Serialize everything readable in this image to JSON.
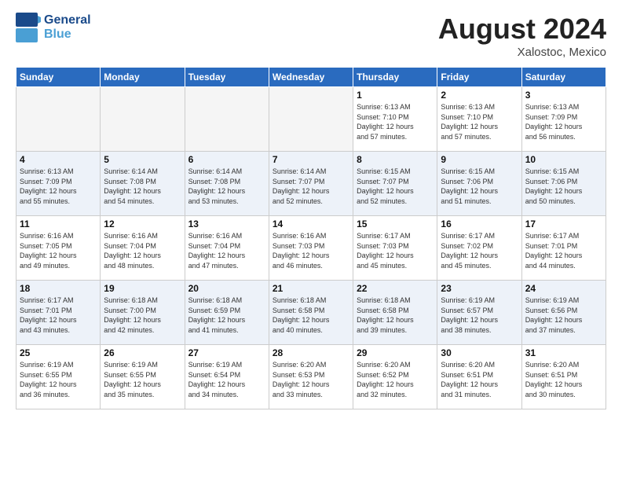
{
  "header": {
    "logo_line1": "General",
    "logo_line2": "Blue",
    "month_year": "August 2024",
    "location": "Xalostoc, Mexico"
  },
  "weekdays": [
    "Sunday",
    "Monday",
    "Tuesday",
    "Wednesday",
    "Thursday",
    "Friday",
    "Saturday"
  ],
  "weeks": [
    [
      {
        "day": "",
        "info": ""
      },
      {
        "day": "",
        "info": ""
      },
      {
        "day": "",
        "info": ""
      },
      {
        "day": "",
        "info": ""
      },
      {
        "day": "1",
        "info": "Sunrise: 6:13 AM\nSunset: 7:10 PM\nDaylight: 12 hours\nand 57 minutes."
      },
      {
        "day": "2",
        "info": "Sunrise: 6:13 AM\nSunset: 7:10 PM\nDaylight: 12 hours\nand 57 minutes."
      },
      {
        "day": "3",
        "info": "Sunrise: 6:13 AM\nSunset: 7:09 PM\nDaylight: 12 hours\nand 56 minutes."
      }
    ],
    [
      {
        "day": "4",
        "info": "Sunrise: 6:13 AM\nSunset: 7:09 PM\nDaylight: 12 hours\nand 55 minutes."
      },
      {
        "day": "5",
        "info": "Sunrise: 6:14 AM\nSunset: 7:08 PM\nDaylight: 12 hours\nand 54 minutes."
      },
      {
        "day": "6",
        "info": "Sunrise: 6:14 AM\nSunset: 7:08 PM\nDaylight: 12 hours\nand 53 minutes."
      },
      {
        "day": "7",
        "info": "Sunrise: 6:14 AM\nSunset: 7:07 PM\nDaylight: 12 hours\nand 52 minutes."
      },
      {
        "day": "8",
        "info": "Sunrise: 6:15 AM\nSunset: 7:07 PM\nDaylight: 12 hours\nand 52 minutes."
      },
      {
        "day": "9",
        "info": "Sunrise: 6:15 AM\nSunset: 7:06 PM\nDaylight: 12 hours\nand 51 minutes."
      },
      {
        "day": "10",
        "info": "Sunrise: 6:15 AM\nSunset: 7:06 PM\nDaylight: 12 hours\nand 50 minutes."
      }
    ],
    [
      {
        "day": "11",
        "info": "Sunrise: 6:16 AM\nSunset: 7:05 PM\nDaylight: 12 hours\nand 49 minutes."
      },
      {
        "day": "12",
        "info": "Sunrise: 6:16 AM\nSunset: 7:04 PM\nDaylight: 12 hours\nand 48 minutes."
      },
      {
        "day": "13",
        "info": "Sunrise: 6:16 AM\nSunset: 7:04 PM\nDaylight: 12 hours\nand 47 minutes."
      },
      {
        "day": "14",
        "info": "Sunrise: 6:16 AM\nSunset: 7:03 PM\nDaylight: 12 hours\nand 46 minutes."
      },
      {
        "day": "15",
        "info": "Sunrise: 6:17 AM\nSunset: 7:03 PM\nDaylight: 12 hours\nand 45 minutes."
      },
      {
        "day": "16",
        "info": "Sunrise: 6:17 AM\nSunset: 7:02 PM\nDaylight: 12 hours\nand 45 minutes."
      },
      {
        "day": "17",
        "info": "Sunrise: 6:17 AM\nSunset: 7:01 PM\nDaylight: 12 hours\nand 44 minutes."
      }
    ],
    [
      {
        "day": "18",
        "info": "Sunrise: 6:17 AM\nSunset: 7:01 PM\nDaylight: 12 hours\nand 43 minutes."
      },
      {
        "day": "19",
        "info": "Sunrise: 6:18 AM\nSunset: 7:00 PM\nDaylight: 12 hours\nand 42 minutes."
      },
      {
        "day": "20",
        "info": "Sunrise: 6:18 AM\nSunset: 6:59 PM\nDaylight: 12 hours\nand 41 minutes."
      },
      {
        "day": "21",
        "info": "Sunrise: 6:18 AM\nSunset: 6:58 PM\nDaylight: 12 hours\nand 40 minutes."
      },
      {
        "day": "22",
        "info": "Sunrise: 6:18 AM\nSunset: 6:58 PM\nDaylight: 12 hours\nand 39 minutes."
      },
      {
        "day": "23",
        "info": "Sunrise: 6:19 AM\nSunset: 6:57 PM\nDaylight: 12 hours\nand 38 minutes."
      },
      {
        "day": "24",
        "info": "Sunrise: 6:19 AM\nSunset: 6:56 PM\nDaylight: 12 hours\nand 37 minutes."
      }
    ],
    [
      {
        "day": "25",
        "info": "Sunrise: 6:19 AM\nSunset: 6:55 PM\nDaylight: 12 hours\nand 36 minutes."
      },
      {
        "day": "26",
        "info": "Sunrise: 6:19 AM\nSunset: 6:55 PM\nDaylight: 12 hours\nand 35 minutes."
      },
      {
        "day": "27",
        "info": "Sunrise: 6:19 AM\nSunset: 6:54 PM\nDaylight: 12 hours\nand 34 minutes."
      },
      {
        "day": "28",
        "info": "Sunrise: 6:20 AM\nSunset: 6:53 PM\nDaylight: 12 hours\nand 33 minutes."
      },
      {
        "day": "29",
        "info": "Sunrise: 6:20 AM\nSunset: 6:52 PM\nDaylight: 12 hours\nand 32 minutes."
      },
      {
        "day": "30",
        "info": "Sunrise: 6:20 AM\nSunset: 6:51 PM\nDaylight: 12 hours\nand 31 minutes."
      },
      {
        "day": "31",
        "info": "Sunrise: 6:20 AM\nSunset: 6:51 PM\nDaylight: 12 hours\nand 30 minutes."
      }
    ]
  ]
}
